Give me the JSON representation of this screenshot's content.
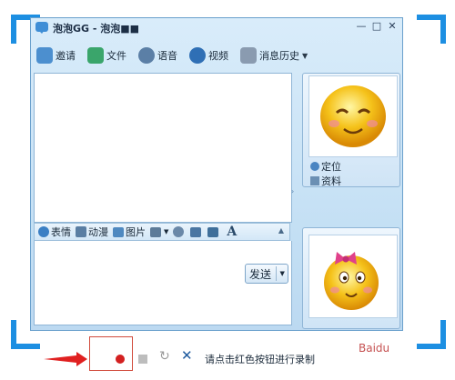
{
  "window": {
    "title": "泡泡GG - 泡泡■■",
    "controls": [
      "—",
      "□",
      "✕"
    ]
  },
  "toolbar": {
    "items": [
      {
        "label": "邀请",
        "icon": "invite-icon"
      },
      {
        "label": "文件",
        "icon": "file-transfer-icon"
      },
      {
        "label": "语音",
        "icon": "voice-icon"
      },
      {
        "label": "视频",
        "icon": "video-icon"
      },
      {
        "label": "消息历史",
        "icon": "message-history-icon",
        "dropdown": true
      }
    ]
  },
  "input_toolbar": {
    "emoji_label": "表情",
    "anim_label": "动漫",
    "picture_label": "图片",
    "font_letter": "A"
  },
  "send": {
    "label": "发送"
  },
  "profile": {
    "locate_label": "定位",
    "info_label": "资料"
  },
  "recorder": {
    "hint": "请点击红色按钮进行录制",
    "record_color": "#d32020"
  },
  "colors": {
    "accent_corner": "#1d8fe2",
    "window_bg": "#c9e2f5"
  }
}
